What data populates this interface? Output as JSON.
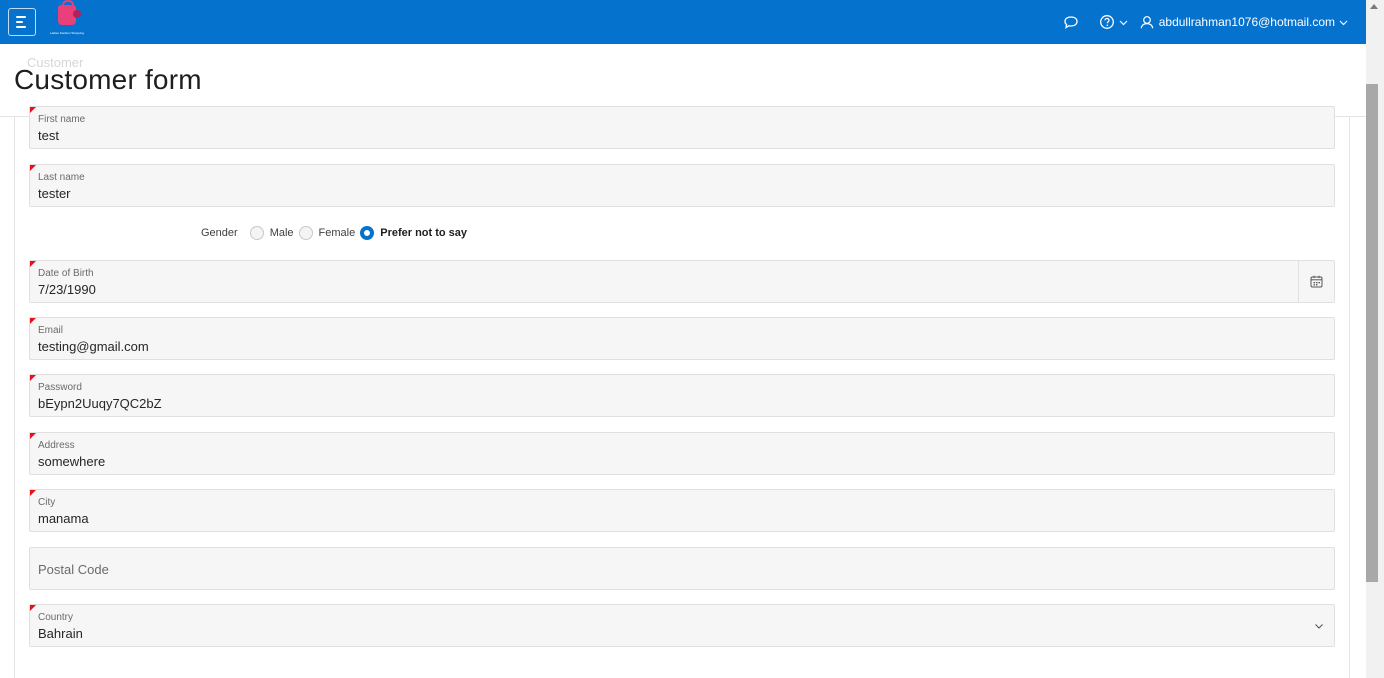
{
  "header": {
    "logo_tagline": "Ladies Fashion Shopping",
    "user_email": "abdullrahman1076@hotmail.com",
    "colors": {
      "bar": "#0572ce"
    }
  },
  "page": {
    "breadcrumb": "Customer",
    "title": "Customer form"
  },
  "form": {
    "first_name": {
      "label": "First name",
      "value": "test"
    },
    "last_name": {
      "label": "Last name",
      "value": "tester"
    },
    "gender": {
      "label": "Gender",
      "options": [
        "Male",
        "Female",
        "Prefer not to say"
      ],
      "selected": "Prefer not to say"
    },
    "dob": {
      "label": "Date of Birth",
      "value": "7/23/1990"
    },
    "email": {
      "label": "Email",
      "value": "testing@gmail.com"
    },
    "password": {
      "label": "Password",
      "value": "bEypn2Uuqy7QC2bZ"
    },
    "address": {
      "label": "Address",
      "value": "somewhere"
    },
    "city": {
      "label": "City",
      "value": "manama"
    },
    "postal_code": {
      "label": "Postal Code",
      "value": ""
    },
    "country": {
      "label": "Country",
      "value": "Bahrain"
    }
  },
  "icons": [
    "menu-icon",
    "chat-icon",
    "help-icon",
    "user-icon",
    "calendar-icon",
    "chevron-down-icon"
  ],
  "colors": {
    "required_marker": "#e8101a",
    "accent": "#0572ce"
  }
}
